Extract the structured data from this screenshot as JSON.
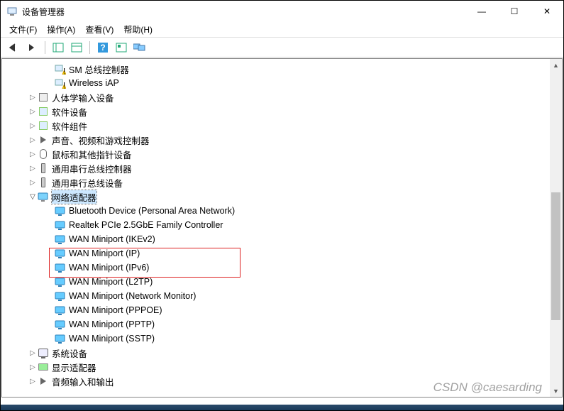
{
  "window": {
    "title": "设备管理器",
    "controls": {
      "min": "—",
      "max": "☐",
      "close": "✕"
    }
  },
  "menu": {
    "file": "文件(F)",
    "action": "操作(A)",
    "view": "查看(V)",
    "help": "帮助(H)"
  },
  "tree": {
    "top_devices": [
      {
        "name": "SM 总线控制器",
        "icon": "warn"
      },
      {
        "name": "Wireless iAP",
        "icon": "warn"
      }
    ],
    "categories": [
      {
        "name": "人体学输入设备",
        "icon": "hid",
        "expanded": false
      },
      {
        "name": "软件设备",
        "icon": "soft",
        "expanded": false
      },
      {
        "name": "软件组件",
        "icon": "soft",
        "expanded": false
      },
      {
        "name": "声音、视频和游戏控制器",
        "icon": "sound",
        "expanded": false
      },
      {
        "name": "鼠标和其他指针设备",
        "icon": "mouse",
        "expanded": false
      },
      {
        "name": "通用串行总线控制器",
        "icon": "usb",
        "expanded": false
      },
      {
        "name": "通用串行总线设备",
        "icon": "usb",
        "expanded": false
      },
      {
        "name": "网络适配器",
        "icon": "net",
        "expanded": true,
        "selected": true,
        "children": [
          "Bluetooth Device (Personal Area Network)",
          "Realtek PCIe 2.5GbE Family Controller",
          "WAN Miniport (IKEv2)",
          "WAN Miniport (IP)",
          "WAN Miniport (IPv6)",
          "WAN Miniport (L2TP)",
          "WAN Miniport (Network Monitor)",
          "WAN Miniport (PPPOE)",
          "WAN Miniport (PPTP)",
          "WAN Miniport (SSTP)"
        ]
      },
      {
        "name": "系统设备",
        "icon": "computer",
        "expanded": false
      },
      {
        "name": "显示适配器",
        "icon": "card",
        "expanded": false
      },
      {
        "name": "音频输入和输出",
        "icon": "sound",
        "expanded": false
      }
    ]
  },
  "highlight": {
    "start": 3,
    "end": 4
  },
  "watermark": "CSDN @caesarding"
}
